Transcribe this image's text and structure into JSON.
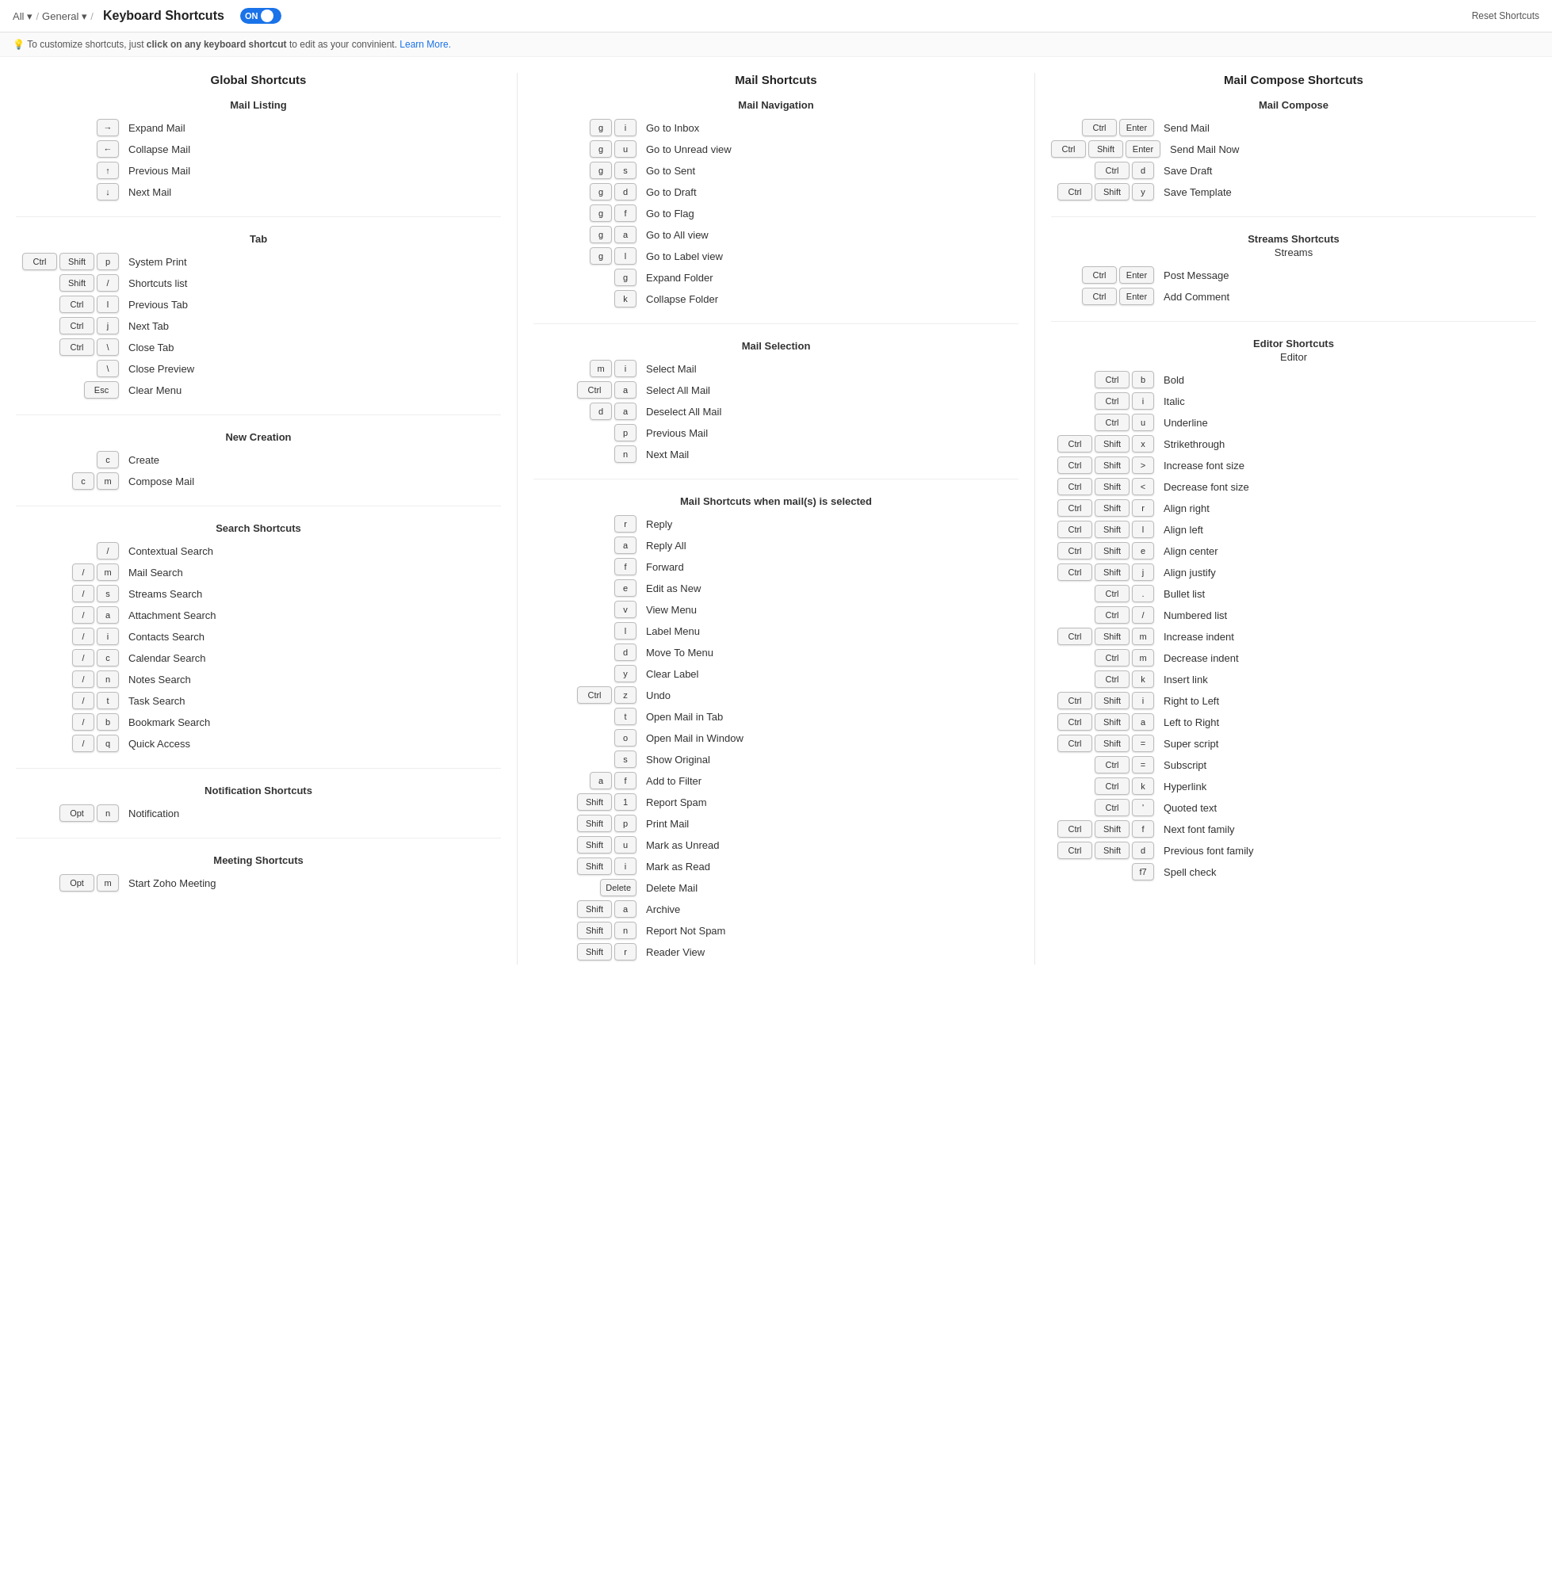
{
  "header": {
    "nav_all": "All",
    "nav_general": "General",
    "title": "Keyboard Shortcuts",
    "toggle_label": "ON",
    "reset_label": "Reset Shortcuts"
  },
  "info": {
    "text_prefix": "To customize shortcuts, just ",
    "bold": "click on any keyboard shortcut",
    "text_suffix": " to edit as your convinient.",
    "link": "Learn More."
  },
  "global": {
    "section_title": "Global Shortcuts",
    "mail_listing": {
      "title": "Mail Listing",
      "items": [
        {
          "keys": [
            "→"
          ],
          "action": "Expand Mail"
        },
        {
          "keys": [
            "←"
          ],
          "action": "Collapse Mail"
        },
        {
          "keys": [
            "↑"
          ],
          "action": "Previous Mail"
        },
        {
          "keys": [
            "↓"
          ],
          "action": "Next Mail"
        }
      ]
    },
    "tab": {
      "title": "Tab",
      "items": [
        {
          "keys": [
            "Ctrl",
            "Shift",
            "p"
          ],
          "action": "System Print"
        },
        {
          "keys": [
            "Shift",
            "/"
          ],
          "action": "Shortcuts list"
        },
        {
          "keys": [
            "Ctrl",
            "l"
          ],
          "action": "Previous Tab"
        },
        {
          "keys": [
            "Ctrl",
            "j"
          ],
          "action": "Next Tab"
        },
        {
          "keys": [
            "Ctrl",
            "\\"
          ],
          "action": "Close Tab"
        },
        {
          "keys": [
            "\\"
          ],
          "action": "Close Preview"
        },
        {
          "keys": [
            "Esc"
          ],
          "action": "Clear Menu"
        }
      ]
    },
    "new_creation": {
      "title": "New Creation",
      "items": [
        {
          "keys": [
            "c"
          ],
          "action": "Create"
        },
        {
          "keys": [
            "c",
            "m"
          ],
          "action": "Compose Mail"
        }
      ]
    },
    "search": {
      "title": "Search Shortcuts",
      "items": [
        {
          "keys": [
            "/"
          ],
          "action": "Contextual Search"
        },
        {
          "keys": [
            "/",
            "m"
          ],
          "action": "Mail Search"
        },
        {
          "keys": [
            "/",
            "s"
          ],
          "action": "Streams Search"
        },
        {
          "keys": [
            "/",
            "a"
          ],
          "action": "Attachment Search"
        },
        {
          "keys": [
            "/",
            "i"
          ],
          "action": "Contacts Search"
        },
        {
          "keys": [
            "/",
            "c"
          ],
          "action": "Calendar Search"
        },
        {
          "keys": [
            "/",
            "n"
          ],
          "action": "Notes Search"
        },
        {
          "keys": [
            "/",
            "t"
          ],
          "action": "Task Search"
        },
        {
          "keys": [
            "/",
            "b"
          ],
          "action": "Bookmark Search"
        },
        {
          "keys": [
            "/",
            "q"
          ],
          "action": "Quick Access"
        }
      ]
    },
    "notification": {
      "title": "Notification Shortcuts",
      "items": [
        {
          "keys": [
            "Opt",
            "n"
          ],
          "action": "Notification"
        }
      ]
    },
    "meeting": {
      "title": "Meeting Shortcuts",
      "items": [
        {
          "keys": [
            "Opt",
            "m"
          ],
          "action": "Start Zoho Meeting"
        }
      ]
    }
  },
  "mail": {
    "section_title": "Mail Shortcuts",
    "navigation": {
      "title": "Mail Navigation",
      "items": [
        {
          "keys": [
            "g",
            "i"
          ],
          "action": "Go to Inbox"
        },
        {
          "keys": [
            "g",
            "u"
          ],
          "action": "Go to Unread view"
        },
        {
          "keys": [
            "g",
            "s"
          ],
          "action": "Go to Sent"
        },
        {
          "keys": [
            "g",
            "d"
          ],
          "action": "Go to Draft"
        },
        {
          "keys": [
            "g",
            "f"
          ],
          "action": "Go to Flag"
        },
        {
          "keys": [
            "g",
            "a"
          ],
          "action": "Go to All view"
        },
        {
          "keys": [
            "g",
            "l"
          ],
          "action": "Go to Label view"
        },
        {
          "keys": [
            "g"
          ],
          "action": "Expand Folder"
        },
        {
          "keys": [
            "k"
          ],
          "action": "Collapse Folder"
        }
      ]
    },
    "selection": {
      "title": "Mail Selection",
      "items": [
        {
          "keys": [
            "m",
            "i"
          ],
          "action": "Select Mail"
        },
        {
          "keys": [
            "Ctrl",
            "a"
          ],
          "action": "Select All Mail"
        },
        {
          "keys": [
            "d",
            "a"
          ],
          "action": "Deselect All Mail"
        },
        {
          "keys": [
            "p"
          ],
          "action": "Previous Mail"
        },
        {
          "keys": [
            "n"
          ],
          "action": "Next Mail"
        }
      ]
    },
    "when_selected": {
      "title": "Mail Shortcuts when mail(s) is selected",
      "items": [
        {
          "keys": [
            "r"
          ],
          "action": "Reply"
        },
        {
          "keys": [
            "a"
          ],
          "action": "Reply All"
        },
        {
          "keys": [
            "f"
          ],
          "action": "Forward"
        },
        {
          "keys": [
            "e"
          ],
          "action": "Edit as New"
        },
        {
          "keys": [
            "v"
          ],
          "action": "View Menu"
        },
        {
          "keys": [
            "l"
          ],
          "action": "Label Menu"
        },
        {
          "keys": [
            "d"
          ],
          "action": "Move To Menu"
        },
        {
          "keys": [
            "y"
          ],
          "action": "Clear Label"
        },
        {
          "keys": [
            "Ctrl",
            "z"
          ],
          "action": "Undo"
        },
        {
          "keys": [
            "t"
          ],
          "action": "Open Mail in Tab"
        },
        {
          "keys": [
            "o"
          ],
          "action": "Open Mail in Window"
        },
        {
          "keys": [
            "s"
          ],
          "action": "Show Original"
        },
        {
          "keys": [
            "a",
            "f"
          ],
          "action": "Add to Filter"
        },
        {
          "keys": [
            "Shift",
            "1"
          ],
          "action": "Report Spam"
        },
        {
          "keys": [
            "Shift",
            "p"
          ],
          "action": "Print Mail"
        },
        {
          "keys": [
            "Shift",
            "u"
          ],
          "action": "Mark as Unread"
        },
        {
          "keys": [
            "Shift",
            "i"
          ],
          "action": "Mark as Read"
        },
        {
          "keys": [
            "Delete"
          ],
          "action": "Delete Mail"
        },
        {
          "keys": [
            "Shift",
            "a"
          ],
          "action": "Archive"
        },
        {
          "keys": [
            "Shift",
            "n"
          ],
          "action": "Report Not Spam"
        },
        {
          "keys": [
            "Shift",
            "r"
          ],
          "action": "Reader View"
        }
      ]
    }
  },
  "compose": {
    "section_title": "Mail Compose Shortcuts",
    "mail_compose": {
      "title": "Mail Compose",
      "items": [
        {
          "keys": [
            "Ctrl",
            "Enter"
          ],
          "action": "Send Mail"
        },
        {
          "keys": [
            "Ctrl",
            "Shift",
            "Enter"
          ],
          "action": "Send Mail Now"
        },
        {
          "keys": [
            "Ctrl",
            "d"
          ],
          "action": "Save Draft"
        },
        {
          "keys": [
            "Ctrl",
            "Shift",
            "y"
          ],
          "action": "Save Template"
        }
      ]
    },
    "streams": {
      "title": "Streams Shortcuts",
      "sub": "Streams",
      "items": [
        {
          "keys": [
            "Ctrl",
            "Enter"
          ],
          "action": "Post Message"
        },
        {
          "keys": [
            "Ctrl",
            "Enter"
          ],
          "action": "Add Comment"
        }
      ]
    },
    "editor": {
      "title": "Editor Shortcuts",
      "sub": "Editor",
      "items": [
        {
          "keys": [
            "Ctrl",
            "b"
          ],
          "action": "Bold"
        },
        {
          "keys": [
            "Ctrl",
            "i"
          ],
          "action": "Italic"
        },
        {
          "keys": [
            "Ctrl",
            "u"
          ],
          "action": "Underline"
        },
        {
          "keys": [
            "Ctrl",
            "Shift",
            "x"
          ],
          "action": "Strikethrough"
        },
        {
          "keys": [
            "Ctrl",
            "Shift",
            ">"
          ],
          "action": "Increase font size"
        },
        {
          "keys": [
            "Ctrl",
            "Shift",
            "<"
          ],
          "action": "Decrease font size"
        },
        {
          "keys": [
            "Ctrl",
            "Shift",
            "r"
          ],
          "action": "Align right"
        },
        {
          "keys": [
            "Ctrl",
            "Shift",
            "l"
          ],
          "action": "Align left"
        },
        {
          "keys": [
            "Ctrl",
            "Shift",
            "e"
          ],
          "action": "Align center"
        },
        {
          "keys": [
            "Ctrl",
            "Shift",
            "j"
          ],
          "action": "Align justify"
        },
        {
          "keys": [
            "Ctrl",
            "."
          ],
          "action": "Bullet list"
        },
        {
          "keys": [
            "Ctrl",
            "/"
          ],
          "action": "Numbered list"
        },
        {
          "keys": [
            "Ctrl",
            "Shift",
            "m"
          ],
          "action": "Increase indent"
        },
        {
          "keys": [
            "Ctrl",
            "m"
          ],
          "action": "Decrease indent"
        },
        {
          "keys": [
            "Ctrl",
            "k"
          ],
          "action": "Insert link"
        },
        {
          "keys": [
            "Ctrl",
            "Shift",
            "i"
          ],
          "action": "Right to Left"
        },
        {
          "keys": [
            "Ctrl",
            "Shift",
            "a"
          ],
          "action": "Left to Right"
        },
        {
          "keys": [
            "Ctrl",
            "Shift",
            "="
          ],
          "action": "Super script"
        },
        {
          "keys": [
            "Ctrl",
            "="
          ],
          "action": "Subscript"
        },
        {
          "keys": [
            "Ctrl",
            "k"
          ],
          "action": "Hyperlink"
        },
        {
          "keys": [
            "Ctrl",
            "'"
          ],
          "action": "Quoted text"
        },
        {
          "keys": [
            "Ctrl",
            "Shift",
            "f"
          ],
          "action": "Next font family"
        },
        {
          "keys": [
            "Ctrl",
            "Shift",
            "d"
          ],
          "action": "Previous font family"
        },
        {
          "keys": [
            "f7"
          ],
          "action": "Spell check"
        }
      ]
    }
  }
}
